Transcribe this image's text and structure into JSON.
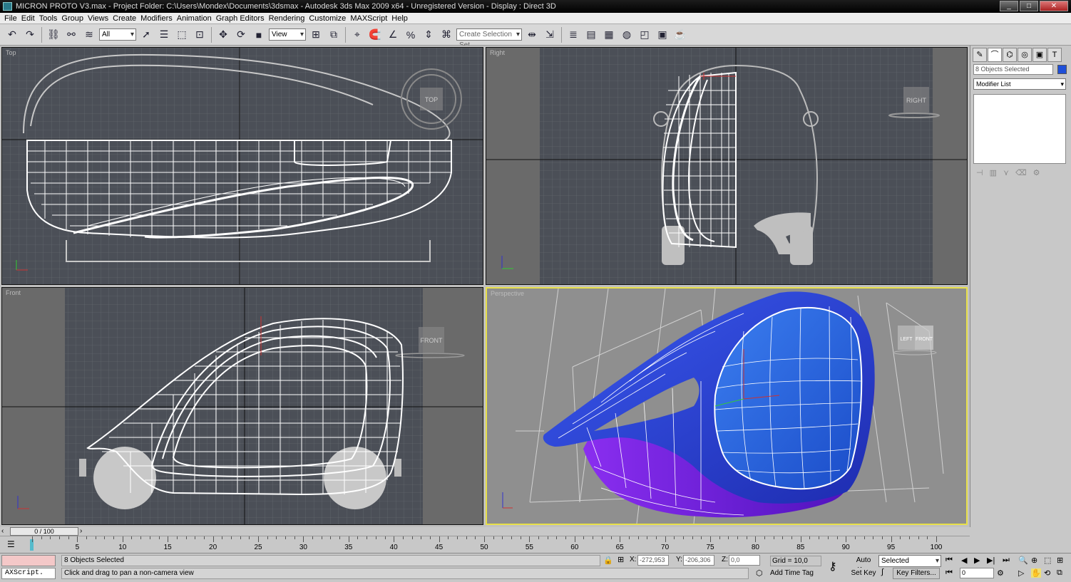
{
  "titlebar": {
    "text": "MICRON PROTO V3.max      - Project Folder: C:\\Users\\Mondex\\Documents\\3dsmax      - Autodesk 3ds Max  2009 x64  - Unregistered Version     - Display : Direct 3D",
    "minimize": "_",
    "restore": "□",
    "close": "✕"
  },
  "menu": [
    "File",
    "Edit",
    "Tools",
    "Group",
    "Views",
    "Create",
    "Modifiers",
    "Animation",
    "Graph Editors",
    "Rendering",
    "Customize",
    "MAXScript",
    "Help"
  ],
  "toolbar": {
    "filter_value": "All",
    "refcoord_value": "View",
    "selection_set_placeholder": "Create Selection Set"
  },
  "viewports": {
    "top": {
      "label": "Top",
      "cube": "TOP"
    },
    "right": {
      "label": "Right",
      "cube": "RIGHT"
    },
    "front": {
      "label": "Front",
      "cube": "FRONT"
    },
    "perspective": {
      "label": "Perspective",
      "cube_left": "LEFT",
      "cube_front": "FRONT"
    }
  },
  "colors": {
    "viewport_bg": "#4b4f57",
    "grid_line": "#6b6f76",
    "wire": "#ffffff",
    "persp_bg": "#8f8f8f",
    "body_blue": "#2a3fd6",
    "body_purple": "#6a1fd8",
    "active_border": "#e8e04a"
  },
  "command_panel": {
    "object_name": "8 Objects Selected",
    "modifier_list": "Modifier List",
    "object_color": "#1f4fd8"
  },
  "timeline": {
    "slider": "0 / 100",
    "ticks": [
      "5",
      "10",
      "15",
      "20",
      "25",
      "30",
      "35",
      "40",
      "45",
      "50",
      "55",
      "60",
      "65",
      "70",
      "75",
      "80",
      "85",
      "90",
      "95",
      "100"
    ]
  },
  "status": {
    "selection": "8 Objects Selected",
    "prompt": "Click and drag to pan a non-camera view",
    "maxscript": "AXScript.",
    "x_label": "X:",
    "x_value": "-272,953",
    "y_label": "Y:",
    "y_value": "-206,306",
    "z_label": "Z:",
    "z_value": "0,0",
    "grid": "Grid = 10,0",
    "auto_key": "Auto Key",
    "set_key": "Set Key",
    "key_mode": "Selected",
    "key_filters": "Key Filters...",
    "add_time_tag": "Add Time Tag",
    "frame": "0"
  }
}
